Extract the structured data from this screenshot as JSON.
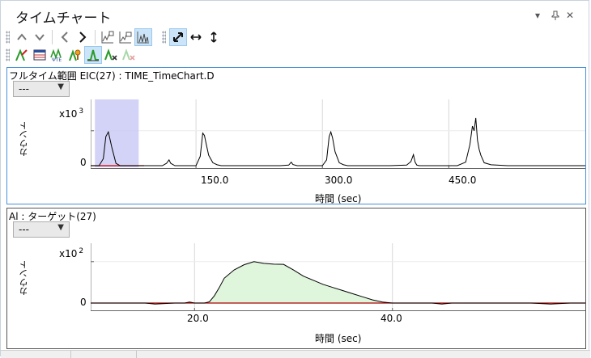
{
  "window": {
    "title": "タイムチャート",
    "controls": {
      "menu": "▾",
      "pin": "📌",
      "close": "✕"
    }
  },
  "toolbar1": {
    "buttons": [
      {
        "name": "scroll-up-icon"
      },
      {
        "name": "scroll-down-icon"
      },
      {
        "name": "previous-icon"
      },
      {
        "name": "next-icon"
      },
      {
        "name": "chart-overlay-icon"
      },
      {
        "name": "chart-stack-icon"
      },
      {
        "name": "chart-bars-icon",
        "active": true
      },
      {
        "name": "autoscale-both-icon",
        "active": true
      },
      {
        "name": "autoscale-x-icon"
      },
      {
        "name": "autoscale-y-icon"
      }
    ]
  },
  "toolbar2": {
    "buttons": [
      {
        "name": "peak-label-icon"
      },
      {
        "name": "table-icon"
      },
      {
        "name": "peak-find-icon"
      },
      {
        "name": "peak-mark-icon"
      },
      {
        "name": "peak-integrate-icon",
        "active": true
      },
      {
        "name": "peak-delete-icon"
      },
      {
        "name": "peak-disabled-icon"
      }
    ]
  },
  "panel1": {
    "title": "フルタイム範囲 EIC(27) : TIME_TimeChart.D",
    "dropdown_value": "---",
    "ylabel": "カウント",
    "multiplier_base": "x10",
    "multiplier_exp": "3",
    "ytick_zero": "0",
    "xticks": [
      "150.0",
      "300.0",
      "450.0"
    ],
    "xlabel": "時間 (sec)",
    "colors": {
      "trace": "#000000",
      "baseline": "#cc0000",
      "highlight": "#c8c8f5",
      "grid": "#d8d8d8"
    }
  },
  "panel2": {
    "title": "Al : ターゲット(27)",
    "dropdown_value": "---",
    "ylabel": "カウント",
    "multiplier_base": "x10",
    "multiplier_exp": "2",
    "ytick_zero": "0",
    "xticks": [
      "20.0",
      "40.0"
    ],
    "xlabel": "時間 (sec)",
    "colors": {
      "trace": "#000000",
      "baseline": "#aa0000",
      "fill": "#dff5dc",
      "grid": "#d8d8d8"
    }
  },
  "chart_data": [
    {
      "type": "line",
      "title": "フルタイム範囲 EIC(27) : TIME_TimeChart.D",
      "xlabel": "時間 (sec)",
      "ylabel": "カウント",
      "y_multiplier": "x10^3",
      "xlim": [
        25,
        612
      ],
      "ylim": [
        0,
        5
      ],
      "x_ticks": [
        150,
        300,
        450
      ],
      "y_ticks": [
        0,
        3
      ],
      "highlight_range": [
        30,
        82
      ],
      "series": [
        {
          "x": [
            25,
            30,
            35,
            40,
            43,
            46,
            50,
            55,
            60,
            70,
            80,
            90,
            100,
            110,
            115,
            118,
            120,
            125,
            130,
            140,
            150,
            155,
            158,
            160,
            162,
            165,
            170,
            175,
            180,
            200,
            230,
            250,
            260,
            263,
            265,
            270,
            280,
            300,
            305,
            308,
            310,
            312,
            315,
            320,
            325,
            330,
            340,
            360,
            380,
            400,
            405,
            408,
            410,
            412,
            415,
            430,
            460,
            470,
            475,
            478,
            480,
            482,
            484,
            486,
            488,
            492,
            500,
            520,
            540,
            560,
            580,
            600,
            612
          ],
          "y": [
            0,
            0,
            0,
            0.6,
            2.5,
            2.9,
            1.6,
            0.2,
            0,
            0,
            0,
            0,
            0,
            0,
            0.2,
            0.5,
            0.2,
            0,
            0,
            0,
            0,
            0.8,
            2.8,
            2.6,
            1.9,
            0.9,
            0.25,
            0.08,
            0,
            0,
            0,
            0,
            0.05,
            0.3,
            0.1,
            0,
            0,
            0,
            0.5,
            2.5,
            2.9,
            2.4,
            1.2,
            0.25,
            0.08,
            0,
            0,
            0,
            0,
            0.05,
            0.35,
            0.95,
            0.3,
            0.05,
            0,
            0,
            0,
            0.3,
            1.8,
            3.4,
            3.0,
            4.1,
            2.2,
            1.4,
            0.9,
            0.25,
            0.08,
            0,
            0,
            0,
            0,
            0,
            0
          ]
        }
      ]
    },
    {
      "type": "area",
      "title": "Al : ターゲット(27)",
      "xlabel": "時間 (sec)",
      "ylabel": "カウント",
      "y_multiplier": "x10^2",
      "xlim": [
        9.5,
        59.5
      ],
      "ylim": [
        0,
        2.5
      ],
      "x_ticks": [
        20,
        40
      ],
      "y_ticks": [
        0,
        2
      ],
      "series": [
        {
          "x": [
            9.5,
            15,
            16,
            18,
            19,
            19.5,
            20,
            21,
            21.5,
            22,
            22.5,
            23,
            24,
            25,
            26,
            27,
            28,
            29,
            30,
            31,
            32,
            33,
            34,
            35,
            36,
            37,
            38,
            39,
            40,
            42,
            44,
            45,
            46,
            48,
            50,
            52,
            54,
            56,
            58,
            59.5
          ],
          "y": [
            0,
            0,
            -0.05,
            0,
            0,
            0.05,
            0,
            0,
            0.06,
            0.35,
            0.75,
            1.2,
            1.6,
            1.85,
            2.0,
            1.92,
            1.88,
            1.87,
            1.6,
            1.3,
            1.1,
            0.9,
            0.75,
            0.6,
            0.45,
            0.3,
            0.15,
            0.05,
            0,
            0,
            0,
            -0.05,
            0,
            0,
            0,
            0,
            0,
            -0.05,
            0,
            0
          ]
        }
      ]
    }
  ]
}
